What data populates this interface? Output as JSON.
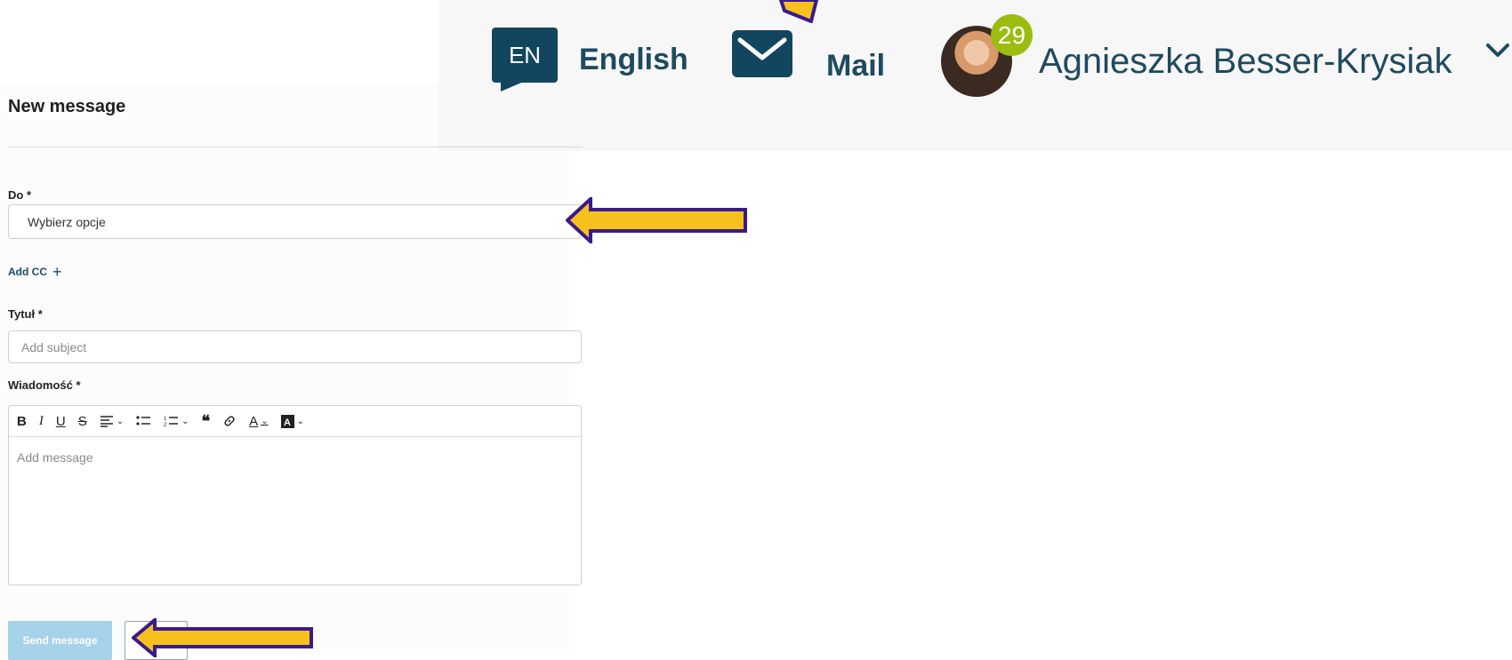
{
  "header": {
    "language_code": "EN",
    "language_label": "English",
    "mail_label": "Mail",
    "notification_count": "29",
    "user_name": "Agnieszka Besser-Krysiak"
  },
  "form": {
    "title": "New message",
    "to_label": "Do *",
    "to_value": "Wybierz opcje",
    "add_cc_label": "Add CC",
    "subject_label": "Tytuł *",
    "subject_placeholder": "Add subject",
    "message_label": "Wiadomość *",
    "message_placeholder": "Add message",
    "send_label": "Send message"
  },
  "toolbar_icons": [
    "bold-icon",
    "italic-icon",
    "underline-icon",
    "strikethrough-icon",
    "align-icon",
    "bullet-list-icon",
    "numbered-list-icon",
    "quote-icon",
    "link-icon",
    "font-color-icon",
    "highlight-icon"
  ],
  "colors": {
    "brand_dark": "#12465e",
    "badge_green": "#9bbd12",
    "send_button": "#a6d3ea",
    "arrow_fill": "#f7c11d",
    "arrow_outline": "#3a1b8c"
  }
}
